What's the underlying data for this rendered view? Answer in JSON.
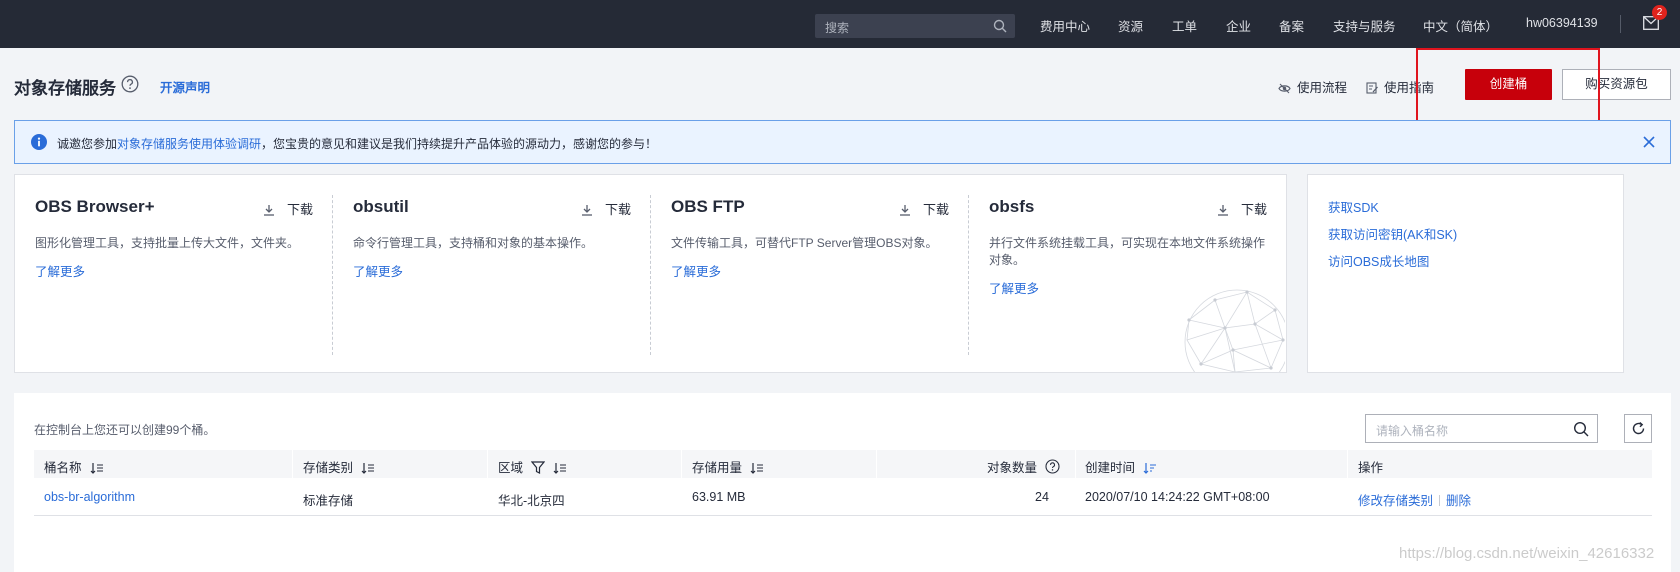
{
  "topbar": {
    "search_placeholder": "搜索",
    "nav": [
      "费用中心",
      "资源",
      "工单",
      "企业",
      "备案",
      "支持与服务",
      "中文（简体）",
      "hw06394139"
    ],
    "mail_badge": "2"
  },
  "header": {
    "title": "对象存储服务",
    "open_source_link": "开源声明",
    "usage_flow": "使用流程",
    "usage_guide": "使用指南",
    "create_bucket": "创建桶",
    "buy_package": "购买资源包"
  },
  "notice": {
    "prefix": "诚邀您参加",
    "link": "对象存储服务使用体验调研",
    "suffix": "，您宝贵的意见和建议是我们持续提升产品体验的源动力，感谢您的参与！"
  },
  "tools": [
    {
      "name": "OBS Browser+",
      "download": "下载",
      "desc": "图形化管理工具，支持批量上传大文件，文件夹。",
      "more": "了解更多"
    },
    {
      "name": "obsutil",
      "download": "下载",
      "desc": "命令行管理工具，支持桶和对象的基本操作。",
      "more": "了解更多"
    },
    {
      "name": "OBS FTP",
      "download": "下载",
      "desc": "文件传输工具，可替代FTP Server管理OBS对象。",
      "more": "了解更多"
    },
    {
      "name": "obsfs",
      "download": "下载",
      "desc": "并行文件系统挂载工具，可实现在本地文件系统操作对象。",
      "more": "了解更多"
    }
  ],
  "side_links": [
    "获取SDK",
    "获取访问密钥(AK和SK)",
    "访问OBS成长地图"
  ],
  "buckets": {
    "tip": "在控制台上您还可以创建99个桶。",
    "search_placeholder": "请输入桶名称",
    "columns": [
      "桶名称",
      "存储类别",
      "区域",
      "存储用量",
      "对象数量",
      "创建时间",
      "操作"
    ],
    "rows": [
      {
        "name": "obs-br-algorithm",
        "storage_class": "标准存储",
        "region": "华北-北京四",
        "usage": "63.91 MB",
        "objects": "24",
        "created": "2020/07/10 14:24:22 GMT+08:00",
        "op_modify": "修改存储类别",
        "op_delete": "删除"
      }
    ]
  },
  "watermark": "https://blog.csdn.net/weixin_42616332",
  "colors": {
    "brand_red": "#c7000b",
    "link_blue": "#2a6cd8",
    "topbar_bg": "#252a36",
    "annotation_red": "#e0141e"
  }
}
